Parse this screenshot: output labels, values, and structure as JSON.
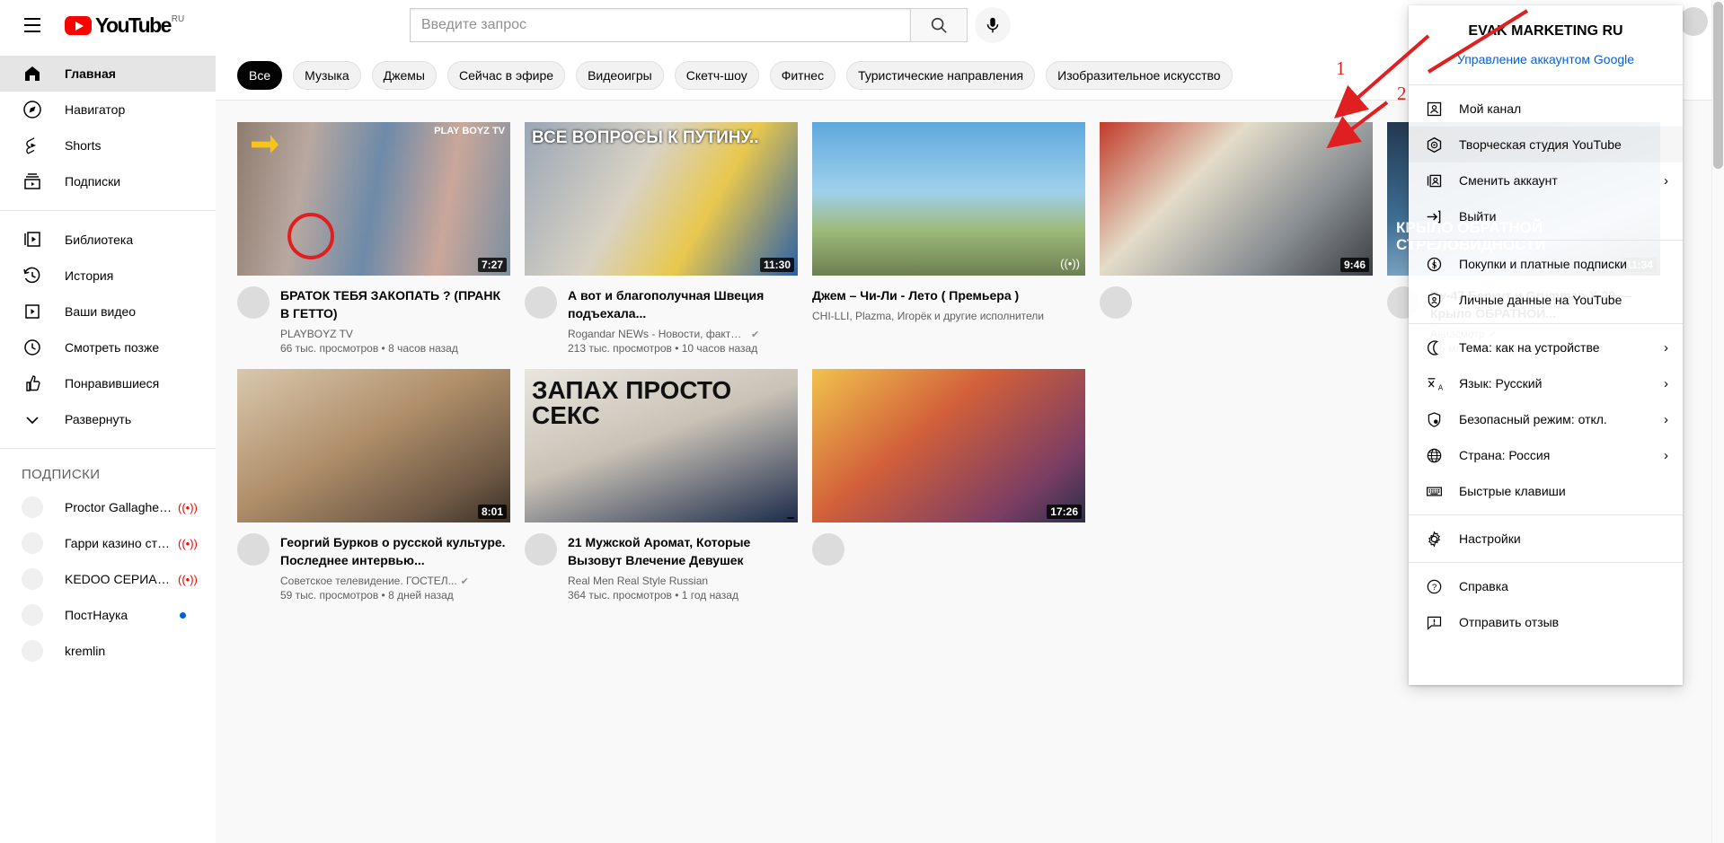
{
  "header": {
    "menu_icon": "hamburger-icon",
    "logo_text": "YouTube",
    "logo_cc": "RU",
    "search_placeholder": "Введите запрос",
    "search_value": "",
    "search_icon": "search-icon",
    "mic_icon": "microphone-icon",
    "avatar": "user-avatar"
  },
  "sidebar": {
    "primary": [
      {
        "label": "Главная",
        "icon": "home-icon",
        "active": true
      },
      {
        "label": "Навигатор",
        "icon": "compass-icon",
        "active": false
      },
      {
        "label": "Shorts",
        "icon": "shorts-icon",
        "active": false
      },
      {
        "label": "Подписки",
        "icon": "subscriptions-icon",
        "active": false
      }
    ],
    "secondary": [
      {
        "label": "Библиотека",
        "icon": "library-icon"
      },
      {
        "label": "История",
        "icon": "history-icon"
      },
      {
        "label": "Ваши видео",
        "icon": "your-videos-icon"
      },
      {
        "label": "Смотреть позже",
        "icon": "clock-icon"
      },
      {
        "label": "Понравившиеся",
        "icon": "thumbs-up-icon"
      },
      {
        "label": "Развернуть",
        "icon": "chevron-down-icon"
      }
    ],
    "subs_header": "ПОДПИСКИ",
    "subscriptions": [
      {
        "name": "Proctor Gallagher I...",
        "live": true,
        "new": false
      },
      {
        "name": "Гарри казино стр...",
        "live": true,
        "new": false
      },
      {
        "name": "KEDOO СЕРИАЛЫ",
        "live": true,
        "new": false
      },
      {
        "name": "ПостНаука",
        "live": false,
        "new": true
      },
      {
        "name": "kremlin",
        "live": false,
        "new": false
      }
    ]
  },
  "chips": [
    {
      "label": "Все",
      "selected": true
    },
    {
      "label": "Музыка",
      "selected": false
    },
    {
      "label": "Джемы",
      "selected": false
    },
    {
      "label": "Сейчас в эфире",
      "selected": false
    },
    {
      "label": "Видеоигры",
      "selected": false
    },
    {
      "label": "Скетч-шоу",
      "selected": false
    },
    {
      "label": "Фитнес",
      "selected": false
    },
    {
      "label": "Туристические направления",
      "selected": false
    },
    {
      "label": "Изобразительное искусство",
      "selected": false
    }
  ],
  "videos": [
    {
      "title": "БРАТОК ТЕБЯ ЗАКОПАТЬ ? (ПРАНК В ГЕТТО)",
      "channel": "PLAYBOYZ TV",
      "verified": false,
      "stats": "66 тыс. просмотров • 8 часов назад",
      "duration": "7:27",
      "live": false,
      "thumb_class": "t1",
      "overlay": "PLAY BOYZ TV"
    },
    {
      "title": "А вот и благополучная Швеция подъехала...",
      "channel": "Rogandar NEWs - Новости, факты,...",
      "verified": true,
      "stats": "213 тыс. просмотров • 10 часов назад",
      "duration": "11:30",
      "live": false,
      "thumb_class": "t2",
      "overlay": "ВСЕ ВОПРОСЫ К ПУТИНУ.."
    },
    {
      "title": "Джем – Чи-Ли - Лето ( Премьера )",
      "channel": "CHI-LLI, Plazma, Игорёк и другие исполнители",
      "verified": false,
      "stats": "",
      "duration": "",
      "live": true,
      "thumb_class": "t3",
      "overlay": ""
    },
    {
      "title": "Су-47 Беркут и Grumman X-29 — Крыло ОБРАТНОЙ...",
      "channel": "Авиасмотр",
      "verified": true,
      "stats": "4,5 млн просмотров • 4 года назад",
      "duration": "11:34",
      "live": false,
      "thumb_class": "t5",
      "overlay": "КРЫЛО ОБРАТНОЙ СТРЕЛОВИДНОСТИ"
    },
    {
      "title": "Георгий Бурков о русской культуре. Последнее интервью...",
      "channel": "Советское телевидение. ГОСТЕЛ...",
      "verified": true,
      "stats": "59 тыс. просмотров • 8 дней назад",
      "duration": "8:01",
      "live": false,
      "thumb_class": "t6",
      "overlay": ""
    },
    {
      "title": "21 Мужской Аромат, Которые Вызовут Влечение Девушек",
      "channel": "Real Men Real Style Russian",
      "verified": false,
      "stats": "364 тыс. просмотров • 1 год назад",
      "duration": "",
      "live": false,
      "thumb_class": "t7",
      "overlay": "ЗАПАХ ПРОСТО СЕКС"
    }
  ],
  "edge_videos": [
    {
      "duration": "9:46",
      "thumb_class": "t4"
    },
    {
      "duration": "17:26",
      "thumb_class": "t9"
    }
  ],
  "account_menu": {
    "name": "EVAK MARKETING RU",
    "manage_link": "Управление аккаунтом Google",
    "groups": [
      {
        "items": [
          {
            "label": "Мой канал",
            "icon": "person-card-icon",
            "arrow": false,
            "highlight": false
          },
          {
            "label": "Творческая студия YouTube",
            "icon": "studio-icon",
            "arrow": false,
            "highlight": true
          },
          {
            "label": "Сменить аккаунт",
            "icon": "switch-account-icon",
            "arrow": true,
            "highlight": false
          },
          {
            "label": "Выйти",
            "icon": "sign-out-icon",
            "arrow": false,
            "highlight": false
          }
        ]
      },
      {
        "items": [
          {
            "label": "Покупки и платные подписки",
            "icon": "dollar-icon",
            "arrow": false,
            "highlight": false
          },
          {
            "label": "Личные данные на YouTube",
            "icon": "privacy-shield-icon",
            "arrow": false,
            "highlight": false
          }
        ]
      },
      {
        "items": [
          {
            "label": "Тема: как на устройстве",
            "icon": "moon-icon",
            "arrow": true,
            "highlight": false
          },
          {
            "label": "Язык: Русский",
            "icon": "translate-icon",
            "arrow": true,
            "highlight": false
          },
          {
            "label": "Безопасный режим: откл.",
            "icon": "safety-shield-icon",
            "arrow": true,
            "highlight": false
          },
          {
            "label": "Страна: Россия",
            "icon": "globe-icon",
            "arrow": true,
            "highlight": false
          },
          {
            "label": "Быстрые клавиши",
            "icon": "keyboard-icon",
            "arrow": false,
            "highlight": false
          }
        ]
      },
      {
        "items": [
          {
            "label": "Настройки",
            "icon": "gear-icon",
            "arrow": false,
            "highlight": false
          }
        ]
      },
      {
        "items": [
          {
            "label": "Справка",
            "icon": "help-icon",
            "arrow": false,
            "highlight": false
          },
          {
            "label": "Отправить отзыв",
            "icon": "feedback-icon",
            "arrow": false,
            "highlight": false
          }
        ]
      }
    ]
  },
  "annotations": [
    {
      "number": "1",
      "color": "#e02020"
    },
    {
      "number": "2",
      "color": "#e02020"
    }
  ]
}
